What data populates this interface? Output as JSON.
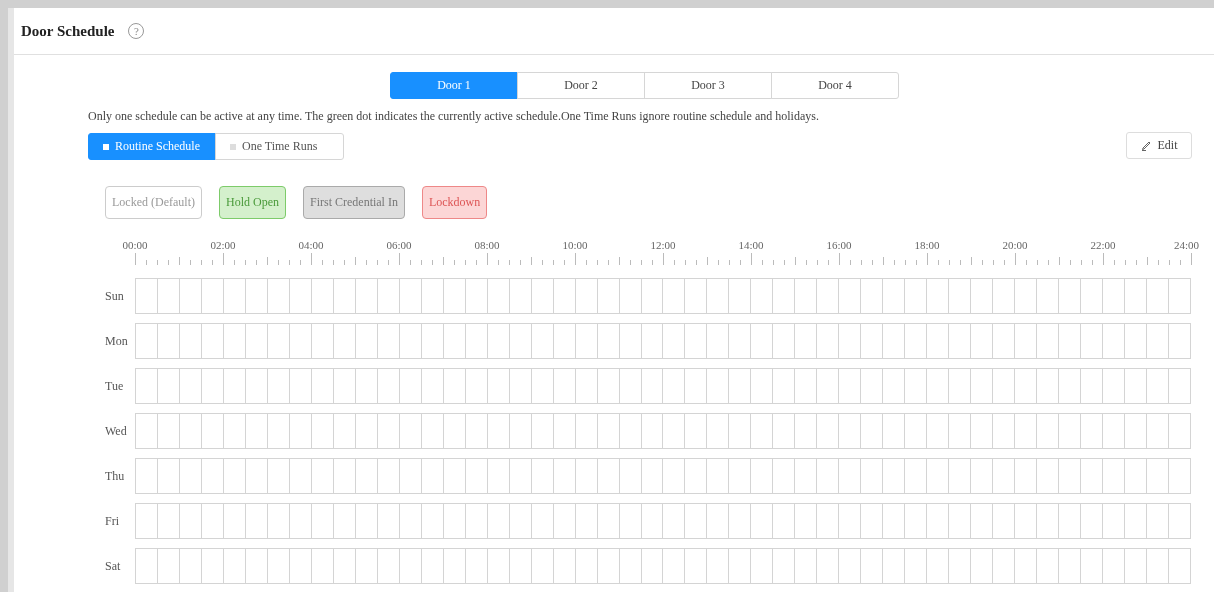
{
  "header": {
    "title": "Door Schedule",
    "help": "?"
  },
  "door_tabs": [
    {
      "label": "Door 1",
      "selected": true
    },
    {
      "label": "Door 2",
      "selected": false
    },
    {
      "label": "Door 3",
      "selected": false
    },
    {
      "label": "Door 4",
      "selected": false
    }
  ],
  "note": "Only one schedule can be active at any time. The green dot indicates the currently active schedule.One Time Runs ignore routine schedule and holidays.",
  "mode_tabs": [
    {
      "label": "Routine Schedule",
      "selected": true
    },
    {
      "label": "One Time Runs",
      "selected": false
    }
  ],
  "edit_button": "Edit",
  "legend": [
    {
      "label": "Locked (Default)",
      "kind": "locked"
    },
    {
      "label": "Hold Open",
      "kind": "hold"
    },
    {
      "label": "First Credential In",
      "kind": "credential"
    },
    {
      "label": "Lockdown",
      "kind": "lockdown"
    }
  ],
  "time_axis": [
    "00:00",
    "02:00",
    "04:00",
    "06:00",
    "08:00",
    "10:00",
    "12:00",
    "14:00",
    "16:00",
    "18:00",
    "20:00",
    "22:00",
    "24:00"
  ],
  "days": [
    "Sun",
    "Mon",
    "Tue",
    "Wed",
    "Thu",
    "Fri",
    "Sat"
  ]
}
